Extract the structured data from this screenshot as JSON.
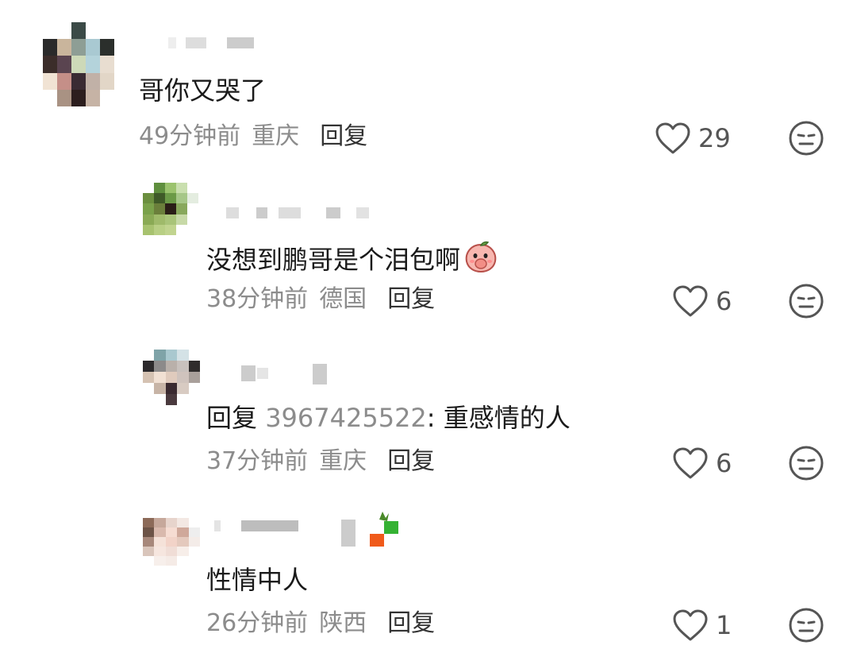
{
  "comments": [
    {
      "content": "哥你又哭了",
      "time": "49分钟前",
      "location": "重庆",
      "reply_label": "回复",
      "likes": "29"
    },
    {
      "content": "没想到鹏哥是个泪包啊",
      "emoji_name": "peach-cover-face-emoji",
      "time": "38分钟前",
      "location": "德国",
      "reply_label": "回复",
      "likes": "6"
    },
    {
      "reply_prefix": "回复",
      "mention": "3967425522",
      "content": ": 重感情的人",
      "time": "37分钟前",
      "location": "重庆",
      "reply_label": "回复",
      "likes": "6"
    },
    {
      "content": "性情中人",
      "time": "26分钟前",
      "location": "陕西",
      "reply_label": "回复",
      "likes": "1"
    }
  ],
  "icons": {
    "like": "heart-outline-icon",
    "dislike": "unhappy-face-icon"
  },
  "colors": {
    "text": "#1a1a1a",
    "meta": "#8c8c8c",
    "icon": "#555555"
  }
}
